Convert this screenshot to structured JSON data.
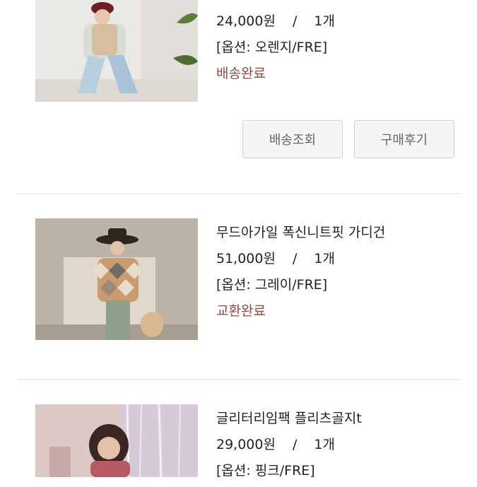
{
  "orders": [
    {
      "price": "24,000원",
      "sep": "/",
      "quantity": "1개",
      "option": "[옵션: 오렌지/FRE]",
      "status": "배송완료",
      "buttons": {
        "track": "배송조회",
        "review": "구매후기"
      }
    },
    {
      "name": "무드아가일 폭신니트핏 가디건",
      "price": "51,000원",
      "sep": "/",
      "quantity": "1개",
      "option": "[옵션: 그레이/FRE]",
      "status": "교환완료"
    },
    {
      "name": "글리터리임팩 플리츠골지t",
      "price": "29,000원",
      "sep": "/",
      "quantity": "1개",
      "option": "[옵션: 핑크/FRE]"
    }
  ]
}
